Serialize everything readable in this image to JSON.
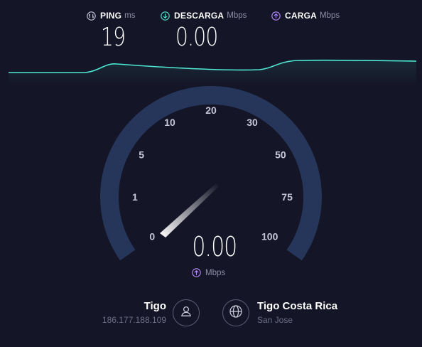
{
  "colors": {
    "background": "#141526",
    "download_accent": "#4ee8d2",
    "upload_accent": "#b88cff",
    "gauge_track": "#26365a",
    "text_muted": "#8d8ea6"
  },
  "metrics": {
    "ping": {
      "icon": "ping-icon",
      "label": "PING",
      "unit": "ms",
      "value": "19"
    },
    "download": {
      "icon": "download-arrow-icon",
      "label": "DESCARGA",
      "unit": "Mbps",
      "value": "0.00"
    },
    "upload": {
      "icon": "upload-arrow-icon",
      "label": "CARGA",
      "unit": "Mbps",
      "value": ""
    }
  },
  "gauge": {
    "scale_labels": [
      "0",
      "1",
      "5",
      "10",
      "20",
      "30",
      "50",
      "75",
      "100"
    ],
    "current_value": "0.00",
    "current_value_number": 0.0,
    "unit": "Mbps",
    "unit_icon": "upload-arrow-icon"
  },
  "client": {
    "icon": "user-icon",
    "name": "Tigo",
    "ip": "186.177.188.109"
  },
  "server": {
    "icon": "globe-icon",
    "name": "Tigo Costa Rica",
    "location": "San Jose"
  }
}
